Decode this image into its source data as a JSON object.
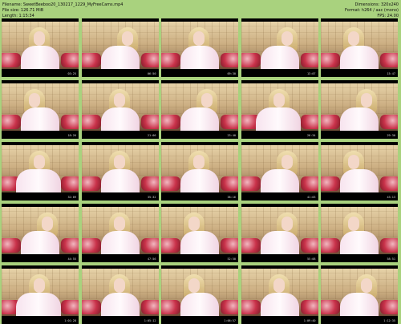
{
  "header": {
    "filename": "Filename: SweetBeeboo20_130217_1229_MyFreeCams.mp4",
    "filesize": "File size: 126.71 MiB",
    "length": "Length: 1:15:34",
    "dimensions": "Dimensions: 320x240",
    "format": "Format: h264 / aac (mono)",
    "fps": "FPS: 24.00"
  },
  "thumbnails": [
    {
      "time": "03:25"
    },
    {
      "time": "06:50"
    },
    {
      "time": "09:30"
    },
    {
      "time": "13:07"
    },
    {
      "time": "15:47"
    },
    {
      "time": "18:26"
    },
    {
      "time": "21:06"
    },
    {
      "time": "23:40"
    },
    {
      "time": "26:34"
    },
    {
      "time": "29:30"
    },
    {
      "time": "32:09"
    },
    {
      "time": "35:32"
    },
    {
      "time": "38:16"
    },
    {
      "time": "41:03"
    },
    {
      "time": "43:13"
    },
    {
      "time": "44:55"
    },
    {
      "time": "47:56"
    },
    {
      "time": "52:50"
    },
    {
      "time": "55:08"
    },
    {
      "time": "58:51"
    },
    {
      "time": "1:01:28"
    },
    {
      "time": "1:05:12"
    },
    {
      "time": "1:06:57"
    },
    {
      "time": "1:09:40"
    },
    {
      "time": "1:12:35"
    }
  ]
}
